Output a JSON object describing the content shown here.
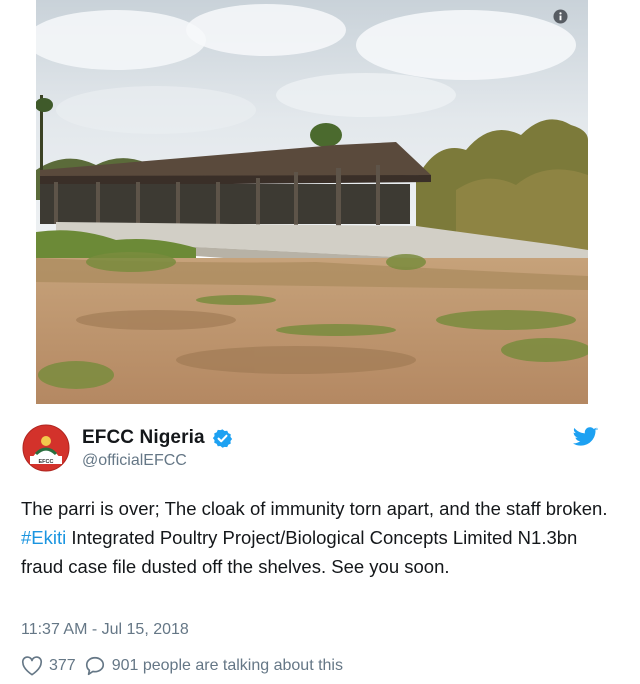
{
  "photo": {
    "alt_description": "",
    "info_icon": "info-icon"
  },
  "tweet": {
    "display_name": "EFCC Nigeria",
    "handle": "@officialEFCC",
    "verified_icon": "verified-badge-icon",
    "platform_icon": "twitter-bird-icon",
    "text_before_hashtag": "The parri is over; The cloak of immunity torn apart, and the staff broken. ",
    "hashtag": "#Ekiti",
    "text_after_hashtag": " Integrated Poultry Project/Biological Concepts Limited N1.3bn fraud case file dusted off the shelves. See you soon.",
    "timestamp": "11:37 AM - Jul 15, 2018",
    "likes": "377",
    "talking": "901 people are talking about this",
    "like_icon": "heart-icon",
    "reply_icon": "speech-bubble-icon"
  },
  "colors": {
    "link": "#1b95e0",
    "secondary_text": "#657786",
    "primary_text": "#14171a",
    "verified": "#1da1f2"
  }
}
